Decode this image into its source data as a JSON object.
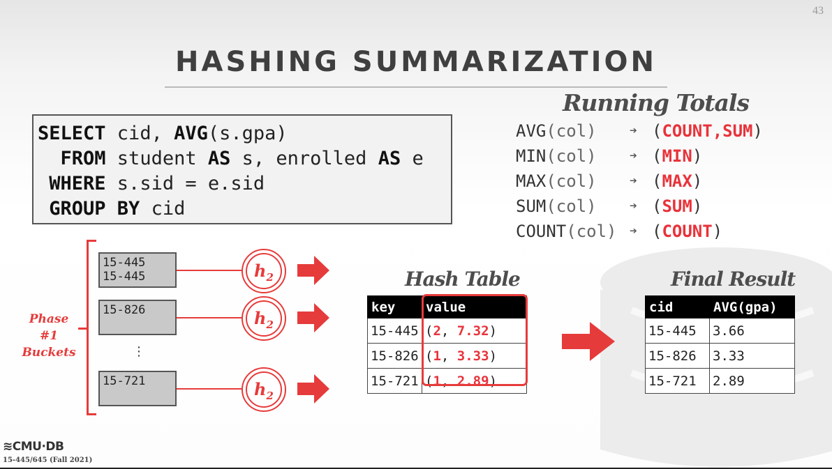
{
  "slide": {
    "number": "43",
    "title": "HASHING SUMMARIZATION"
  },
  "sql": {
    "lines": [
      [
        {
          "t": "SELECT",
          "kw": true
        },
        {
          "t": " cid, "
        },
        {
          "t": "AVG",
          "kw": true
        },
        {
          "t": "(s.gpa)"
        }
      ],
      [
        {
          "t": "  FROM",
          "kw": true
        },
        {
          "t": " student "
        },
        {
          "t": "AS",
          "kw": true
        },
        {
          "t": " s, enrolled "
        },
        {
          "t": "AS",
          "kw": true
        },
        {
          "t": " e"
        }
      ],
      [
        {
          "t": " WHERE",
          "kw": true
        },
        {
          "t": " s.sid = e.sid"
        }
      ],
      [
        {
          "t": " GROUP BY",
          "kw": true
        },
        {
          "t": " cid"
        }
      ]
    ]
  },
  "running_totals": {
    "title": "Running Totals",
    "arrow": "➔",
    "rows": [
      {
        "fn": "AVG",
        "arg": "(col)",
        "result": "COUNT,SUM"
      },
      {
        "fn": "MIN",
        "arg": "(col)",
        "result": "MIN"
      },
      {
        "fn": "MAX",
        "arg": "(col)",
        "result": "MAX"
      },
      {
        "fn": "SUM",
        "arg": "(col)",
        "result": "SUM"
      },
      {
        "fn": "COUNT",
        "arg": "(col)",
        "result": "COUNT"
      }
    ]
  },
  "phase": {
    "label_line1": "Phase #1",
    "label_line2": "Buckets"
  },
  "buckets": [
    {
      "entries": [
        "15-445",
        "15-445"
      ]
    },
    {
      "entries": [
        "15-826"
      ]
    },
    {
      "entries": [
        "15-721"
      ]
    }
  ],
  "bucket_ellipsis": "⋮",
  "hash_fn": {
    "name": "h",
    "subscript": "2"
  },
  "hash_table": {
    "title": "Hash Table",
    "headers": [
      "key",
      "value"
    ],
    "rows": [
      {
        "key": "15-445",
        "count": "2",
        "sum": "7.32"
      },
      {
        "key": "15-826",
        "count": "1",
        "sum": "3.33"
      },
      {
        "key": "15-721",
        "count": "1",
        "sum": "2.89"
      }
    ]
  },
  "final_result": {
    "title": "Final Result",
    "headers": [
      "cid",
      "AVG(gpa)"
    ],
    "rows": [
      [
        "15-445",
        "3.66"
      ],
      [
        "15-826",
        "3.33"
      ],
      [
        "15-721",
        "2.89"
      ]
    ]
  },
  "footer": {
    "logo": "CMU·DB",
    "course": "15-445/645 (Fall 2021)"
  },
  "colors": {
    "accent_red": "#e63b3b",
    "title_gray": "#3f3f3f"
  }
}
